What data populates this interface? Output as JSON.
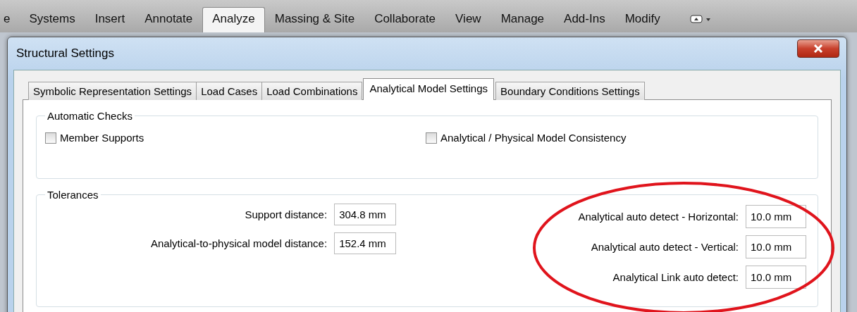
{
  "ribbon_tabs": [
    {
      "label": "e",
      "selected": false
    },
    {
      "label": "Systems",
      "selected": false
    },
    {
      "label": "Insert",
      "selected": false
    },
    {
      "label": "Annotate",
      "selected": false
    },
    {
      "label": "Analyze",
      "selected": true
    },
    {
      "label": "Massing & Site",
      "selected": false
    },
    {
      "label": "Collaborate",
      "selected": false
    },
    {
      "label": "View",
      "selected": false
    },
    {
      "label": "Manage",
      "selected": false
    },
    {
      "label": "Add-Ins",
      "selected": false
    },
    {
      "label": "Modify",
      "selected": false
    }
  ],
  "window": {
    "title": "Structural Settings"
  },
  "tabs": [
    {
      "label": "Symbolic Representation Settings",
      "selected": false
    },
    {
      "label": "Load Cases",
      "selected": false
    },
    {
      "label": "Load Combinations",
      "selected": false
    },
    {
      "label": "Analytical Model Settings",
      "selected": true
    },
    {
      "label": "Boundary Conditions Settings",
      "selected": false
    }
  ],
  "automatic_checks": {
    "title": "Automatic Checks",
    "items": [
      {
        "label": "Member Supports",
        "checked": false
      },
      {
        "label": "Analytical / Physical Model Consistency",
        "checked": false
      }
    ]
  },
  "tolerances": {
    "title": "Tolerances",
    "left": [
      {
        "label": "Support distance:",
        "value": "304.8 mm"
      },
      {
        "label": "Analytical-to-physical model distance:",
        "value": "152.4 mm"
      }
    ],
    "right": [
      {
        "label": "Analytical auto detect - Horizontal:",
        "value": "10.0 mm"
      },
      {
        "label": "Analytical auto detect - Vertical:",
        "value": "10.0 mm"
      },
      {
        "label": "Analytical Link auto detect:",
        "value": "10.0 mm"
      }
    ]
  }
}
